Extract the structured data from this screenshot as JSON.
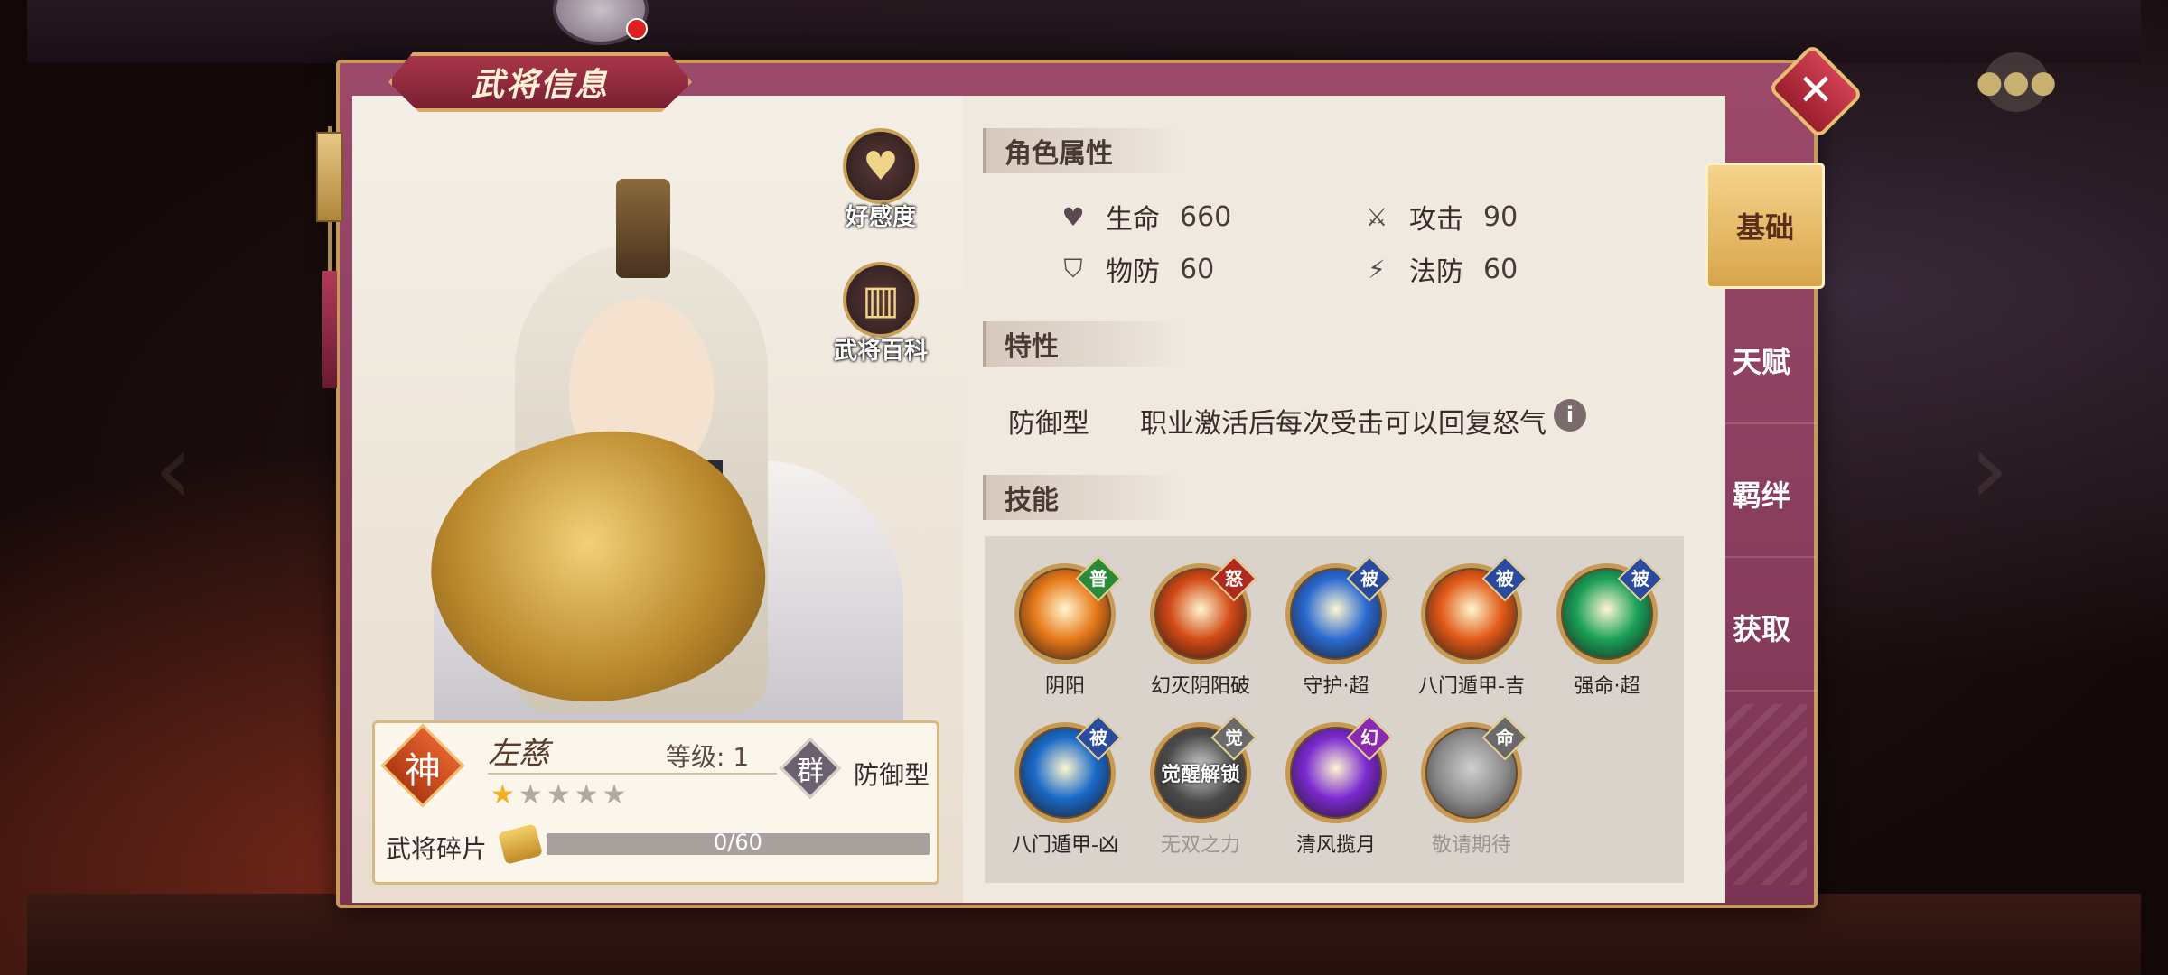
{
  "window": {
    "title": "武将信息"
  },
  "hero": {
    "name": "左慈",
    "rank": "神",
    "level_label": "等级: 1",
    "faction": "群",
    "role": "防御型",
    "stars_filled": 1,
    "stars_total": 5,
    "shards_label": "武将碎片",
    "shards_progress": "0/60",
    "shards_fraction": 0
  },
  "side_buttons": {
    "affinity": "好感度",
    "encyclopedia": "武将百科"
  },
  "attributes": {
    "title": "角色属性",
    "hp_label": "生命",
    "hp_value": "660",
    "atk_label": "攻击",
    "atk_value": "90",
    "pdef_label": "物防",
    "pdef_value": "60",
    "mdef_label": "法防",
    "mdef_value": "60"
  },
  "trait": {
    "title": "特性",
    "type": "防御型",
    "description": "职业激活后每次受击可以回复怒气"
  },
  "skills": {
    "title": "技能",
    "items": [
      {
        "name": "阴阳",
        "tag": "普",
        "tag_color": "#2a8a3a",
        "color": "#e87a1a",
        "locked": false,
        "overlay": ""
      },
      {
        "name": "幻灭阴阳破",
        "tag": "怒",
        "tag_color": "#b02a20",
        "color": "#d24a16",
        "locked": false,
        "overlay": ""
      },
      {
        "name": "守护·超",
        "tag": "被",
        "tag_color": "#2a4aa0",
        "color": "#2a6ad0",
        "locked": false,
        "overlay": ""
      },
      {
        "name": "八门遁甲-吉",
        "tag": "被",
        "tag_color": "#2a4aa0",
        "color": "#e25a18",
        "locked": false,
        "overlay": ""
      },
      {
        "name": "强命·超",
        "tag": "被",
        "tag_color": "#2a4aa0",
        "color": "#1aa058",
        "locked": false,
        "overlay": ""
      },
      {
        "name": "八门遁甲-凶",
        "tag": "被",
        "tag_color": "#2a4aa0",
        "color": "#1a6ac8",
        "locked": false,
        "overlay": ""
      },
      {
        "name": "无双之力",
        "tag": "觉",
        "tag_color": "#6a6a6a",
        "color": "#4a4a4a",
        "locked": true,
        "overlay": "觉醒解锁"
      },
      {
        "name": "清风揽月",
        "tag": "幻",
        "tag_color": "#8a2ab0",
        "color": "#7a2ad0",
        "locked": false,
        "overlay": ""
      },
      {
        "name": "敬请期待",
        "tag": "命",
        "tag_color": "#6a6a6a",
        "color": "#8a8a8a",
        "locked": true,
        "overlay": ""
      }
    ]
  },
  "tabs": [
    "基础",
    "天赋",
    "羁绊",
    "获取"
  ],
  "colors": {
    "accent": "#d8a44a",
    "frame": "#9c4a6a",
    "rank": "#e2602c"
  }
}
